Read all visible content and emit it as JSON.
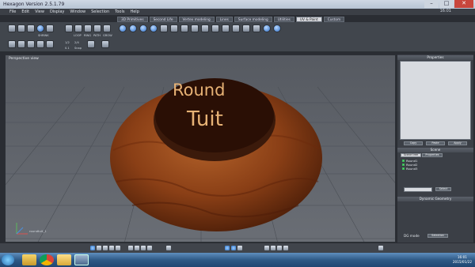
{
  "window": {
    "title": "Hexagon Version 2.5.1.79"
  },
  "menu": [
    "File",
    "Edit",
    "View",
    "Display",
    "Window",
    "Selection",
    "Tools",
    "Help"
  ],
  "clock": "16:01",
  "tabs": [
    "3D Primitives",
    "Second Life",
    "Vertex modeling",
    "Lines",
    "Surface modeling",
    "Utilities",
    "UV & Paint",
    "Custom"
  ],
  "active_tab": "UV & Paint",
  "toolbar": {
    "loop": "LOOP",
    "ring": "RING",
    "path": "PATH",
    "grow": "GROW",
    "shrink": "SHRINK",
    "num_left": "1/2",
    "num_right": "2/4",
    "snap": "Snap",
    "field_value": "0.1"
  },
  "viewport": {
    "label": "Perspective view",
    "object_text_line1": "Round",
    "object_text_line2": "Tuit",
    "gizmo_label": "roundtuit_1"
  },
  "panels": {
    "properties": {
      "title": "Properties",
      "buttons": [
        "Copy",
        "Paste",
        "Apply"
      ]
    },
    "scene": {
      "title": "Scene",
      "tabs": [
        "Scene tree",
        "Properties"
      ],
      "items": [
        "Round1",
        "Round2",
        "Round3"
      ],
      "button": "Select"
    },
    "dynamic": {
      "title": "Dynamic Geometry",
      "mode_label": "DG mode",
      "mode_value": "Selection"
    }
  },
  "taskbar": {
    "time": "16:01",
    "date": "2015/01/22"
  }
}
